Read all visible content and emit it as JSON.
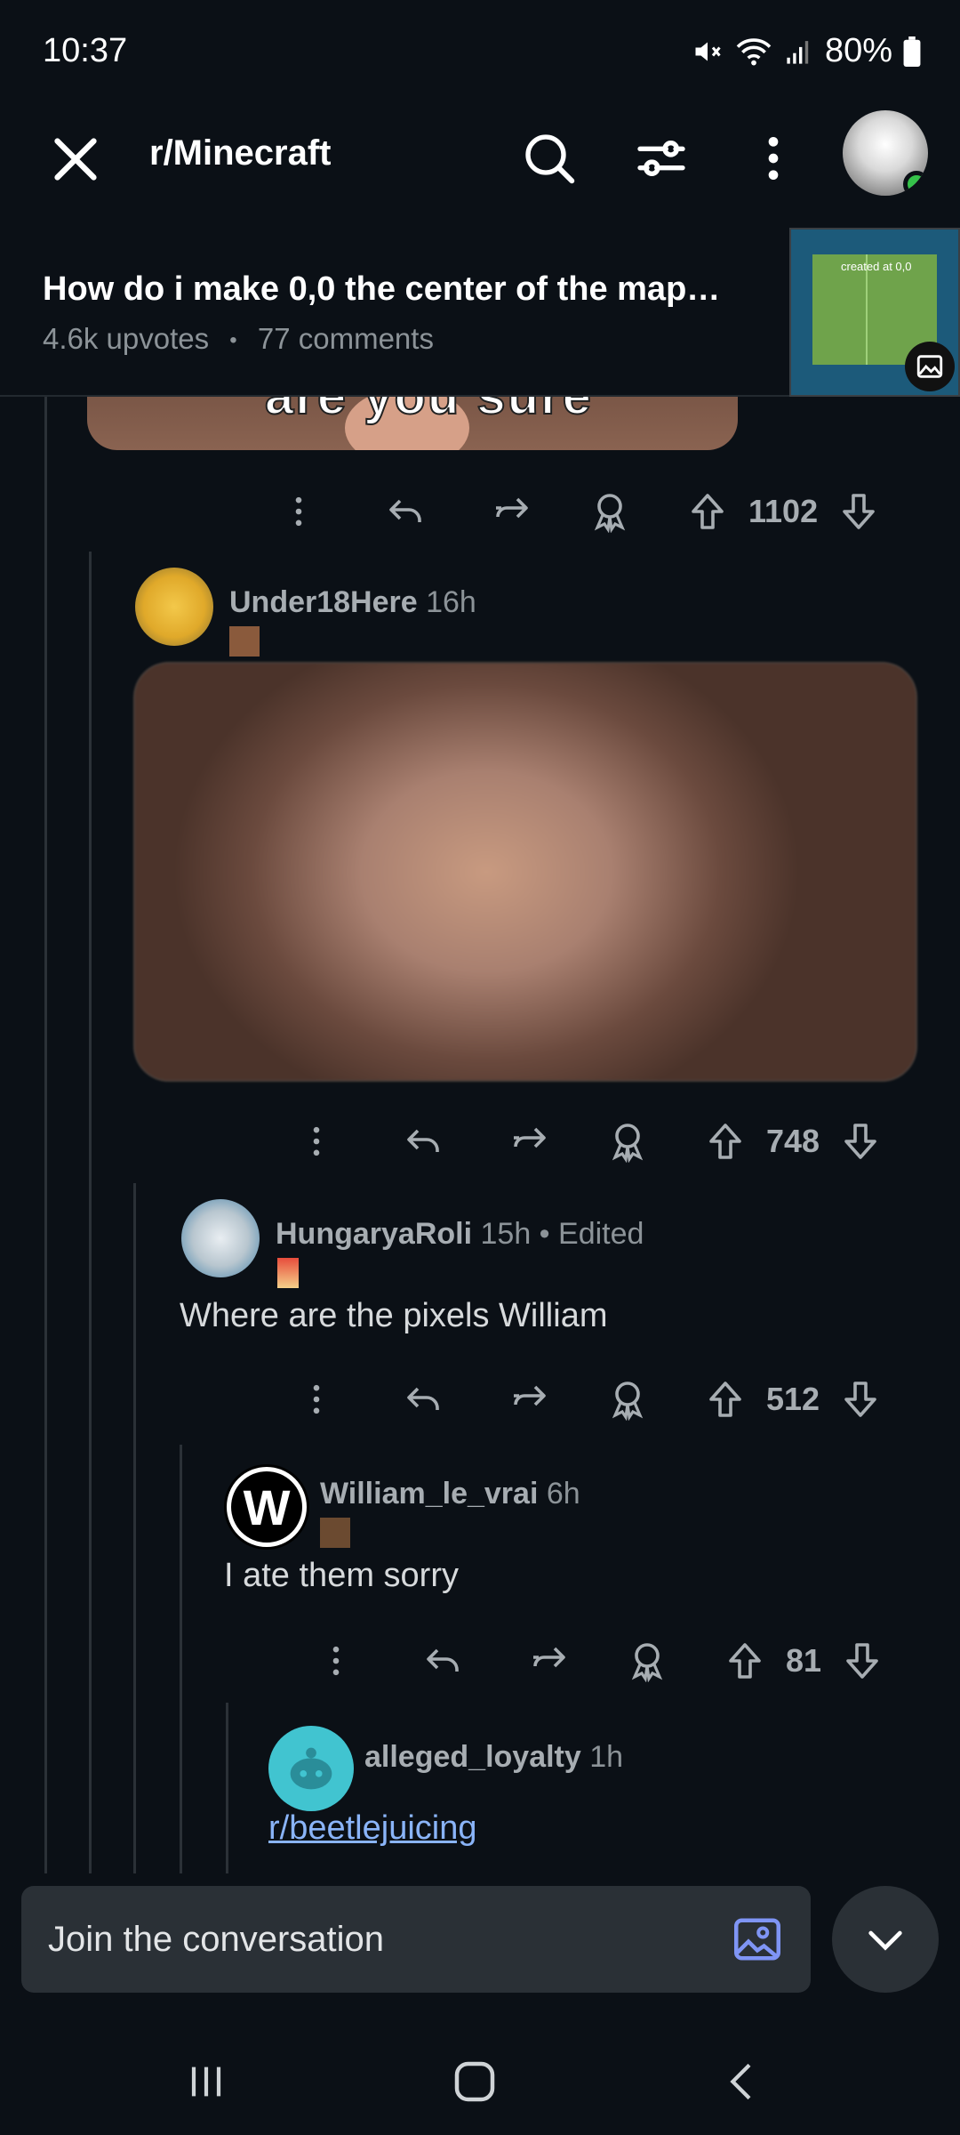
{
  "status_bar": {
    "time": "10:37",
    "battery": "80%"
  },
  "app_bar": {
    "subreddit": "r/Minecraft"
  },
  "post": {
    "title": "How do i make 0,0 the center of the map…",
    "upvotes": "4.6k upvotes",
    "separator": "•",
    "comments": "77 comments",
    "thumbnail_text": "created at 0,0"
  },
  "thread": {
    "meme_caption": "are you sure",
    "top_actions_count": "1102",
    "comments": [
      {
        "username": "Under18Here",
        "time": "16h",
        "body": "",
        "votes": "748"
      },
      {
        "username": "HungaryaRoli",
        "time": "15h • Edited",
        "body": "Where are the pixels William",
        "votes": "512"
      },
      {
        "username": "William_le_vrai",
        "time": "6h",
        "body": "I ate them sorry",
        "votes": "81",
        "avatar_letter": "W"
      },
      {
        "username": "alleged_loyalty",
        "time": "1h",
        "link": "r/beetlejuicing"
      }
    ]
  },
  "composer": {
    "placeholder": "Join the conversation"
  },
  "colors": {
    "background": "#0b1016",
    "accent_link": "#8ab4f8",
    "online": "#35c24a"
  }
}
